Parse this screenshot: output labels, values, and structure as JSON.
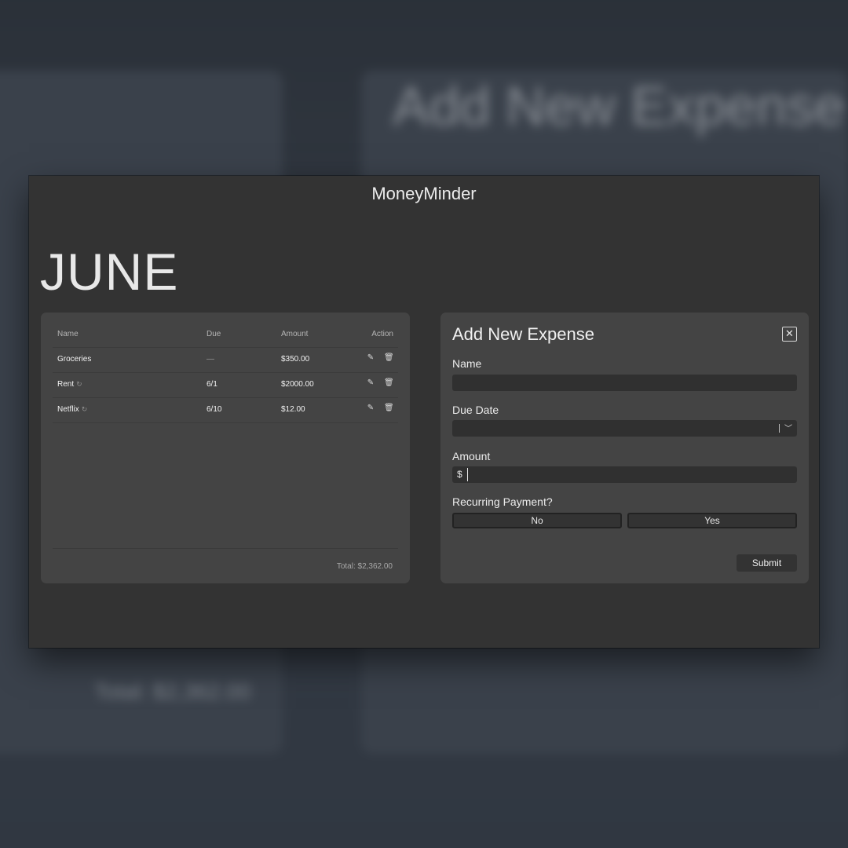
{
  "app": {
    "title": "MoneyMinder",
    "month": "JUNE"
  },
  "background": {
    "heading": "Add New Expense",
    "total": "Total: $2,362.00"
  },
  "expense_list": {
    "columns": [
      "Name",
      "Due",
      "Amount",
      "Action"
    ],
    "rows": [
      {
        "name": "Groceries",
        "due": "—",
        "amount": "$350.00",
        "recurring": false
      },
      {
        "name": "Rent",
        "due": "6/1",
        "amount": "$2000.00",
        "recurring": true
      },
      {
        "name": "Netflix",
        "due": "6/10",
        "amount": "$12.00",
        "recurring": true
      }
    ],
    "total": "Total: $2,362.00",
    "icons": {
      "recurring": "refresh-icon",
      "edit": "pencil-icon",
      "delete": "trash-icon"
    }
  },
  "form": {
    "title": "Add New Expense",
    "close_icon": "close-icon",
    "name_label": "Name",
    "name_value": "",
    "due_label": "Due Date",
    "due_value": "",
    "amount_label": "Amount",
    "currency_symbol": "$",
    "amount_value": "",
    "recurring_label": "Recurring Payment?",
    "recurring_no": "No",
    "recurring_yes": "Yes",
    "submit_label": "Submit"
  }
}
